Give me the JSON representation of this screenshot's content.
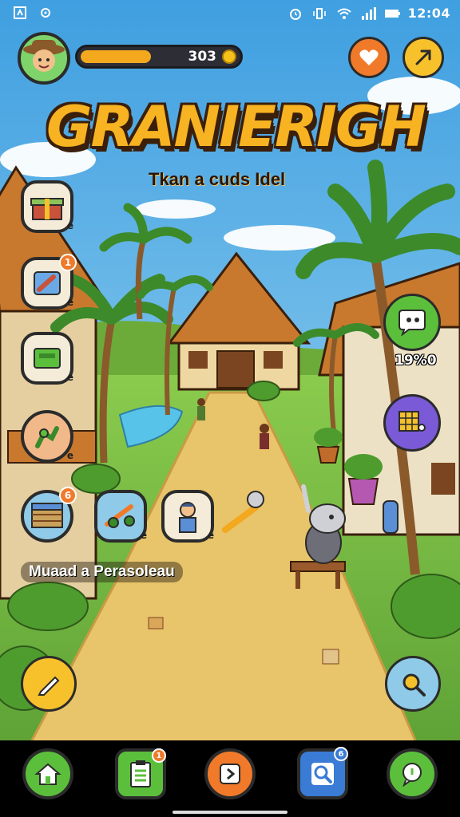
{
  "status_bar": {
    "time": "12:04",
    "icons": [
      "notification-icon",
      "settings-icon",
      "alarm-icon",
      "vibrate-icon",
      "wifi-icon",
      "signal-icon",
      "battery-icon"
    ]
  },
  "hud": {
    "player_avatar": "player-avatar-icon",
    "xp_progress": 0.45,
    "currency_value": "303",
    "currency_icon": "coin-icon",
    "favorites_icon": "heart-icon",
    "share_icon": "send-icon"
  },
  "title": {
    "main": "GRANIERIGH",
    "subtitle": "Tkan a cuds Idel"
  },
  "left_items": [
    {
      "icon": "gift-box-icon",
      "badge": "",
      "tag": "e"
    },
    {
      "icon": "tools-icon",
      "badge": "1",
      "tag": "e"
    },
    {
      "icon": "machine-icon",
      "badge": "",
      "tag": "e"
    },
    {
      "icon": "crafting-icon",
      "badge": "",
      "tag": "e"
    },
    {
      "icon": "crate-icon",
      "badge": "6",
      "tag": ""
    },
    {
      "icon": "fishing-gear-icon",
      "badge": "",
      "tag": "e"
    },
    {
      "icon": "villager-icon",
      "badge": "",
      "tag": "e"
    }
  ],
  "left_label": "Muaad a Perasoleau",
  "right_panel": {
    "chat_icon": "chat-bubble-icon",
    "count": "19%0",
    "grid_icon": "map-grid-icon",
    "search_icon": "magnify-icon"
  },
  "edit_icon": "pencil-icon",
  "bottom_nav": [
    {
      "icon": "home-icon",
      "color": "#5bbf3c",
      "badge": ""
    },
    {
      "icon": "clipboard-icon",
      "color": "#5bbf3c",
      "badge": "1"
    },
    {
      "icon": "play-icon",
      "color": "#f07a2a",
      "badge": ""
    },
    {
      "icon": "search-icon",
      "color": "#3a7bd5",
      "badge": "6"
    },
    {
      "icon": "chat-icon",
      "color": "#5bbf3c",
      "badge": ""
    }
  ],
  "colors": {
    "sky": "#5bb6e8",
    "path": "#e8c46a",
    "grass": "#7ac043",
    "accent_orange": "#f3a81d",
    "title_yellow": "#f7b321"
  }
}
